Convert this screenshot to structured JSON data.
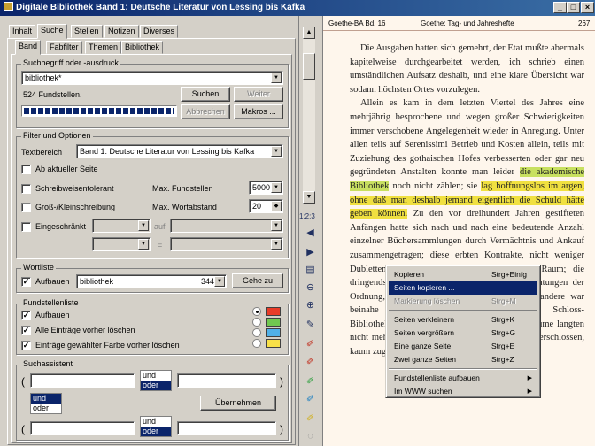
{
  "window": {
    "title": "Digitale Bibliothek Band 1: Deutsche Literatur von Lessing bis Kafka",
    "min": "_",
    "max": "□",
    "close": "×"
  },
  "top_tabs": [
    "Inhalt",
    "Suche",
    "Stellen",
    "Notizen",
    "Diverses"
  ],
  "sub_tabs": [
    "Band",
    "Fabfilter",
    "Themen",
    "Bibliothek"
  ],
  "search": {
    "group_label": "Suchbegriff oder -ausdruck",
    "query": "bibliothek*",
    "hits": "524 Fundstellen.",
    "search_btn": "Suchen",
    "next_btn": "Weiter",
    "cancel_btn": "Abbrechen",
    "macros_btn": "Makros ...",
    "progress": 1.0
  },
  "filter": {
    "group_label": "Filter und Optionen",
    "scope_label": "Textbereich",
    "scope_value": "Band 1: Deutsche Literatur von Lessing bis Kafka",
    "from_page": "Ab aktueller Seite",
    "tolerant": "Schreibweisentolerant",
    "case": "Groß-/Kleinschreibung",
    "restricted": "Eingeschränkt",
    "max_hits_label": "Max. Fundstellen",
    "max_hits_value": "5000",
    "max_dist_label": "Max. Wortabstand",
    "max_dist_value": "20",
    "auf_label": "auf",
    "op_label": "="
  },
  "wordlist": {
    "group_label": "Wortliste",
    "build_label": "Aufbauen",
    "term": "bibliothek",
    "count": "344",
    "goto_btn": "Gehe zu"
  },
  "hitlist": {
    "group_label": "Fundstellenliste",
    "build_label": "Aufbauen",
    "clear_label": "Alle Einträge vorher löschen",
    "color_clear_label": "Einträge gewählter Farbe vorher löschen",
    "colors": [
      "#e83c28",
      "#70c850",
      "#50b0e8",
      "#f8e048"
    ]
  },
  "assistant": {
    "group_label": "Suchassistent",
    "ops": [
      "und",
      "oder"
    ],
    "apply_btn": "Übernehmen",
    "paren_open": "(",
    "paren_close": ")"
  },
  "toolstrip": {
    "label": "1:2:3"
  },
  "doc": {
    "source": "Goethe-BA Bd. 16",
    "header": "Goethe: Tag- und Jahreshefte",
    "page": "267",
    "p1": "Die Ausgaben hatten sich gemehrt, der Etat mußte abermals kapitelweise durchgearbeitet werden, ich schrieb einen umständlichen Aufsatz deshalb, und eine klare Übersicht war sodann höchsten Ortes vorzulegen.",
    "p2a": "Allein es kam in dem letzten Viertel des Jahres eine mehrjährig besprochene und wegen großer Schwierigkeiten immer verschobene Angelegenheit wieder in Anregung. Unter allen teils auf Serenissimi Betrieb und Kosten allein, teils mit Zuziehung des gothaischen Hofes verbesserten oder gar neu gegründeten Anstalten konnte man leider ",
    "p2hl1": "die akademische Bibliothek",
    "p2b": " noch nicht zählen; sie ",
    "p2hl2": "lag hoffnungslos im argen, ohne daß man deshalb jemand eigentlich die Schuld hätte geben können.",
    "p2c": " Zu den vor dreihundert Jahren gestifteten Anfängen hatte sich nach und nach eine bedeutende Anzahl einzelner Büchersammlungen durch Vermächtnis und Ankauf zusammengetragen; diese erbten Kontrakte, nicht weniger Dubletten und mannigfaltige Weise gefüllten Raum; die dringendsten Lokale Wahl die zufälligen Einrichtungen der Ordnung, die sonst standen. Wie so manches andere war beinahe ein Jahrhundert lang ihre Schloss-Bibliothekdienerschaft; sie blieb in eben dem Räume langten nicht mehr zu, die Büderische Bibliothek stand verschlossen, kaum zugänglich; so sollte nach"
  },
  "context_menu": {
    "items": [
      {
        "label": "Kopieren",
        "shortcut": "Strg+Einfg",
        "state": "normal"
      },
      {
        "label": "Seiten kopieren ...",
        "shortcut": "",
        "state": "selected"
      },
      {
        "label": "Markierung löschen",
        "shortcut": "Strg+M",
        "state": "disabled"
      },
      {
        "label": "Seiten verkleinern",
        "shortcut": "Strg+K",
        "state": "normal"
      },
      {
        "label": "Seiten vergrößern",
        "shortcut": "Strg+G",
        "state": "normal"
      },
      {
        "label": "Eine ganze Seite",
        "shortcut": "Strg+E",
        "state": "normal"
      },
      {
        "label": "Zwei ganze Seiten",
        "shortcut": "Strg+Z",
        "state": "normal"
      },
      {
        "label": "Fundstellenliste aufbauen",
        "shortcut": "",
        "state": "normal"
      },
      {
        "label": "Im WWW suchen",
        "shortcut": "",
        "state": "normal"
      }
    ]
  }
}
